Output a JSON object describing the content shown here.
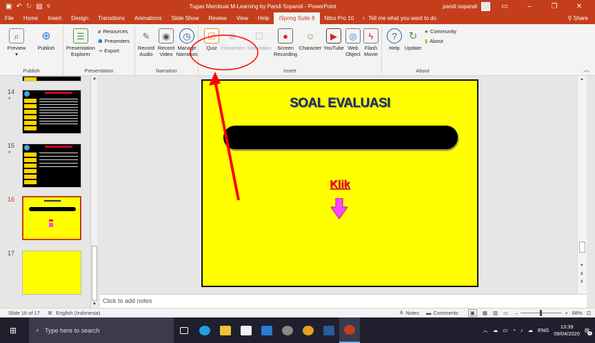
{
  "window": {
    "title": "Tugas Membuat M-Learning by Pandi Sopandi  -  PowerPoint",
    "user": "pandi sopandi"
  },
  "menu": {
    "tabs": [
      "File",
      "Home",
      "Insert",
      "Design",
      "Transitions",
      "Animations",
      "Slide Show",
      "Review",
      "View",
      "Help",
      "iSpring Suite 8",
      "Nitro Pro 10"
    ],
    "active_tab": "iSpring Suite 8",
    "tell_me": "Tell me what you want to do",
    "share": "Share"
  },
  "ribbon": {
    "publish": {
      "name": "Publish",
      "preview": "Preview",
      "publish": "Publish"
    },
    "presentation": {
      "name": "Presentation",
      "explorer": "Presentation Explorer",
      "resources": "Resources",
      "presenters": "Presenters",
      "export": "Export"
    },
    "narration": {
      "name": "Narration",
      "record_audio": "Record Audio",
      "record_video": "Record Video",
      "manage_narration": "Manage Narration"
    },
    "insert": {
      "name": "Insert",
      "quiz": "Quiz",
      "interaction": "Interaction",
      "simulation": "Simulation",
      "screen_recording": "Screen Recording",
      "character": "Character",
      "youtube": "YouTube",
      "web_object": "Web Object",
      "flash_movie": "Flash Movie"
    },
    "about": {
      "name": "About",
      "help": "Help",
      "update": "Update",
      "community": "Community",
      "about": "About"
    }
  },
  "slides_panel": {
    "items": [
      {
        "num": "14",
        "star": "*"
      },
      {
        "num": "15",
        "star": "*"
      },
      {
        "num": "16",
        "star": ""
      },
      {
        "num": "17",
        "star": ""
      }
    ]
  },
  "slide": {
    "title": "SOAL EVALUASI",
    "link_text": "Klik"
  },
  "notes": {
    "placeholder": "Click to add notes"
  },
  "status": {
    "slide_info": "Slide 16 of 17",
    "language": "English (Indonesia)",
    "notes": "Notes",
    "comments": "Comments",
    "zoom": "68%"
  },
  "taskbar": {
    "search_placeholder": "Type here to search",
    "language": "ENG",
    "time": "13:39",
    "date": "09/04/2020",
    "notifications": "2"
  },
  "colors": {
    "accent": "#c43e1c",
    "slide_bg": "#ffff00",
    "annotation": "#ff0000"
  }
}
